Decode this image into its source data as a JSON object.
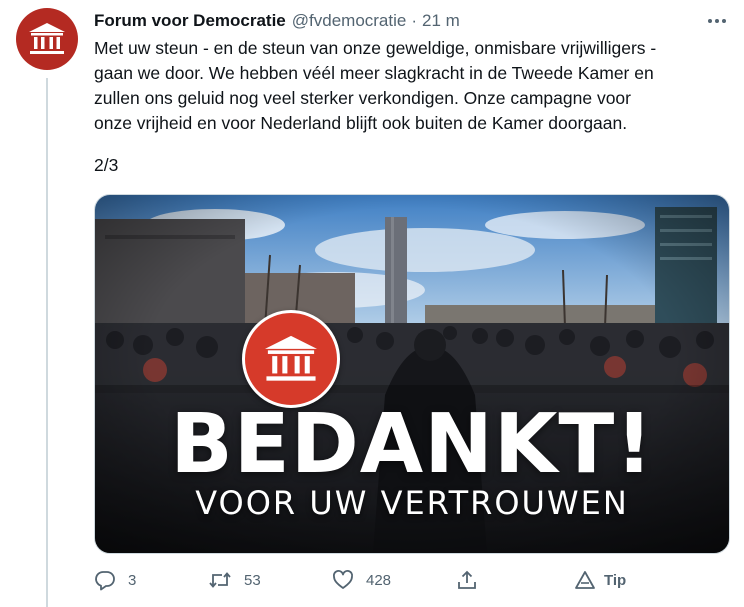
{
  "tweet": {
    "author": {
      "name": "Forum voor Democratie",
      "handle": "@fvdemocratie",
      "separator": "·",
      "time": "21 m"
    },
    "text_lines": [
      "Met uw steun - en de steun van onze geweldige, onmisbare vrijwilligers -",
      "gaan we door. We hebben véél meer slagkracht in de Tweede Kamer en",
      "zullen ons geluid nog veel sterker verkondigen. Onze campagne voor",
      "onze vrijheid en voor Nederland blijft ook buiten de Kamer doorgaan."
    ],
    "thread_count": "2/3",
    "media": {
      "headline": "BEDANKT!",
      "subline": "VOOR UW VERTROUWEN"
    },
    "actions": {
      "reply_count": "3",
      "retweet_count": "53",
      "like_count": "428",
      "tip_label": "Tip"
    }
  },
  "colors": {
    "brand_red": "#b42a22",
    "badge_red": "#d63a2a",
    "secondary_text": "#536471",
    "divider": "#cfd9de"
  },
  "icons": [
    "party-logo-icon",
    "more-icon",
    "reply-icon",
    "retweet-icon",
    "like-icon",
    "share-icon",
    "tip-icon"
  ]
}
